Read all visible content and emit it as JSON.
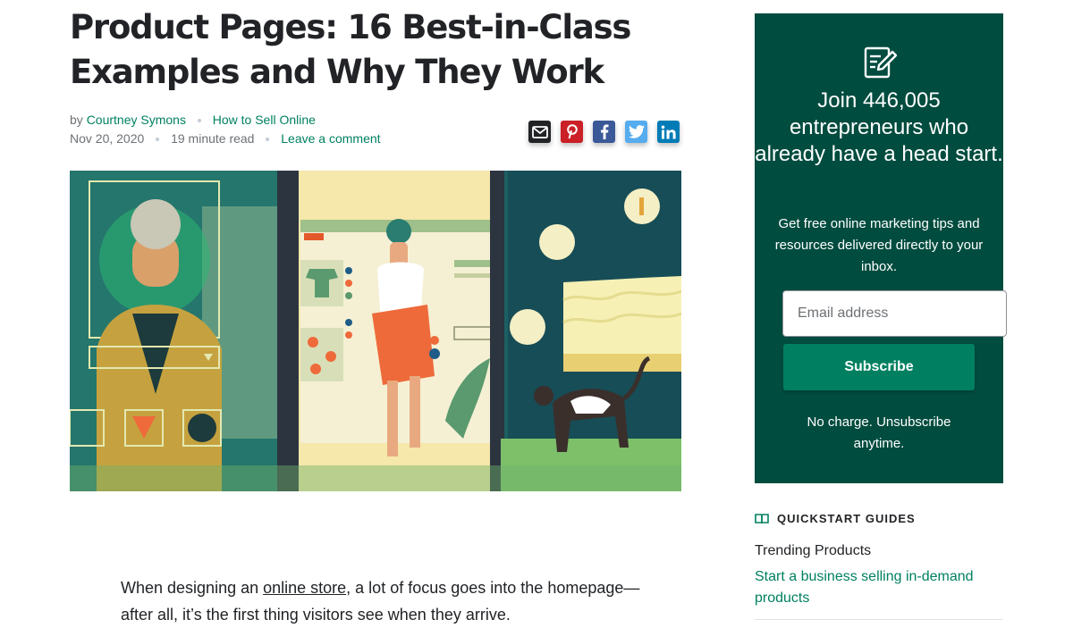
{
  "article": {
    "title": "Product Pages: 16 Best-in-Class Examples and Why They Work",
    "by_label": "by",
    "author": "Courtney Symons",
    "category": "How to Sell Online",
    "date": "Nov 20, 2020",
    "read_time": "19 minute read",
    "comment_link": "Leave a comment",
    "share_icons": [
      "email-icon",
      "pinterest-icon",
      "facebook-icon",
      "twitter-icon",
      "linkedin-icon"
    ],
    "share_colors": {
      "email": "#212326",
      "pinterest": "#cb2027",
      "facebook": "#3b5998",
      "twitter": "#55acee",
      "linkedin": "#007bb6"
    },
    "intro_before_link": "When designing an ",
    "intro_link": "online store",
    "intro_after_link": ", a lot of focus goes into the homepage—after all, it’s the first thing visitors see when they arrive."
  },
  "signup": {
    "heading": "Join 446,005 entrepreneurs who already have a head start.",
    "description": "Get free online marketing tips and resources delivered directly to your inbox.",
    "email_placeholder": "Email address",
    "subscribe_label": "Subscribe",
    "no_charge": "No charge. Unsubscribe anytime."
  },
  "quickstart": {
    "heading": "QUICKSTART GUIDES",
    "item_title": "Trending Products",
    "item_link": "Start a business selling in-demand products"
  },
  "colors": {
    "brand_dark": "#004c3f",
    "brand_green": "#008060"
  }
}
